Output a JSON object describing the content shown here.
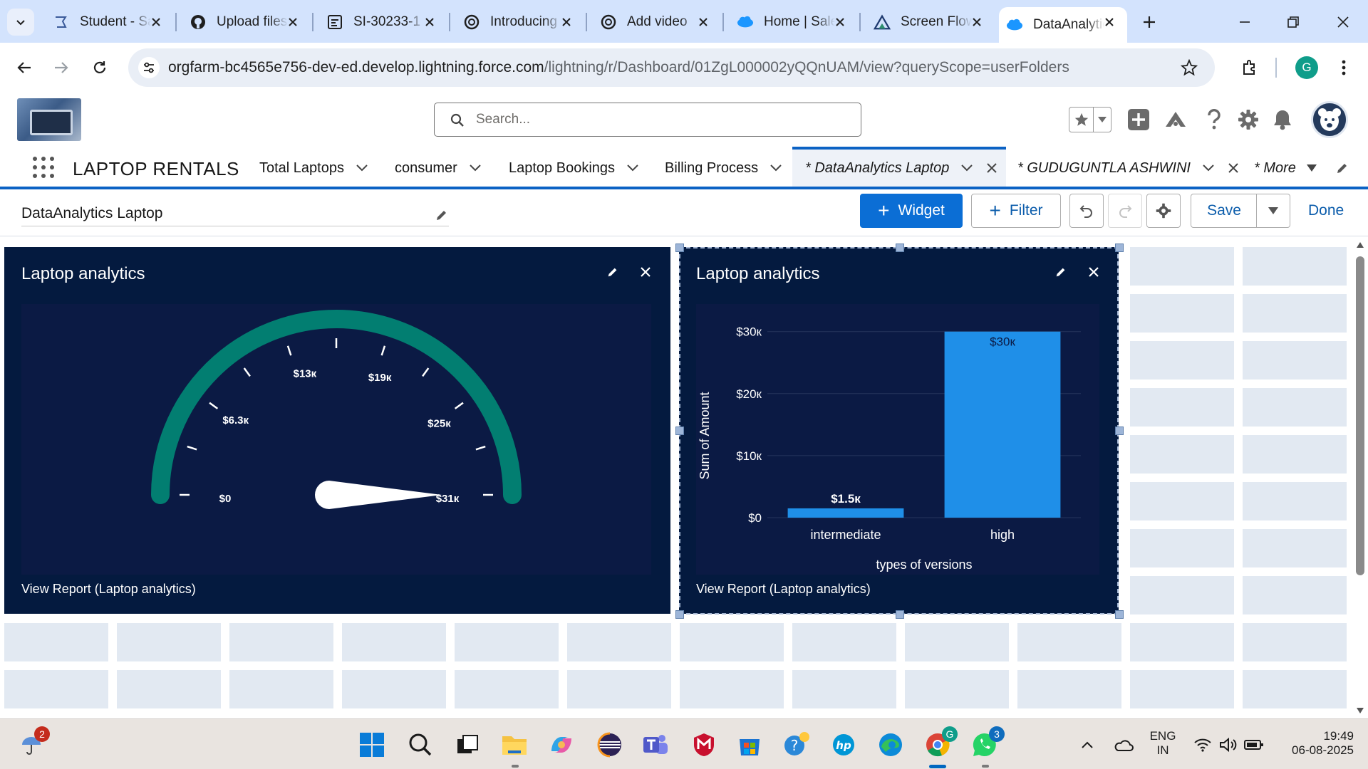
{
  "browser": {
    "tabs": [
      {
        "label": "Student - Salesforce",
        "icon": "salesforce-student-icon"
      },
      {
        "label": "Upload files",
        "icon": "github-icon"
      },
      {
        "label": "SI-30233-1",
        "icon": "document-icon"
      },
      {
        "label": "Introducing",
        "icon": "openai-icon"
      },
      {
        "label": "Add video",
        "icon": "openai-icon"
      },
      {
        "label": "Home | Salesforce",
        "icon": "salesforce-cloud-icon"
      },
      {
        "label": "Screen Flow",
        "icon": "trailhead-icon"
      },
      {
        "label": "DataAnalytics",
        "icon": "salesforce-cloud-icon",
        "active": true
      }
    ],
    "url_host": "orgfarm-bc4565e756-dev-ed.develop.lightning.force.com",
    "url_path": "/lightning/r/Dashboard/01ZgL000002yQQnUAM/view?queryScope=userFolders",
    "profile_initial": "G"
  },
  "header": {
    "search_placeholder": "Search..."
  },
  "nav": {
    "app_name": "LAPTOP RENTALS",
    "items": [
      {
        "label": "Total Laptops"
      },
      {
        "label": "consumer"
      },
      {
        "label": "Laptop Bookings"
      },
      {
        "label": "Billing Process"
      },
      {
        "label": "* DataAnalytics Laptop",
        "active": true
      },
      {
        "label": "* GUDUGUNTLA ASHWINI"
      },
      {
        "label": "* More"
      }
    ]
  },
  "editbar": {
    "dashboard_title": "DataAnalytics Laptop",
    "widget_label": "Widget",
    "filter_label": "Filter",
    "save_label": "Save",
    "done_label": "Done"
  },
  "gauge_widget": {
    "title": "Laptop analytics",
    "link": "View Report (Laptop analytics)",
    "chart_data": {
      "type": "gauge",
      "min": 0,
      "max": 31000,
      "value": 31000,
      "labels": [
        "$0",
        "$6.3к",
        "$13к",
        "$19к",
        "$25к",
        "$31к"
      ],
      "label_values": [
        0,
        6300,
        13000,
        19000,
        25000,
        31000
      ],
      "colors": {
        "arc": "#027e71",
        "needle": "#ffffff"
      }
    }
  },
  "bar_widget": {
    "title": "Laptop analytics",
    "link": "View Report (Laptop analytics)",
    "chart_data": {
      "type": "bar",
      "categories": [
        "intermediate",
        "high"
      ],
      "values": [
        1500,
        30000
      ],
      "data_labels": [
        "$1.5к",
        "$30к"
      ],
      "xlabel": "types of versions",
      "ylabel": "Sum of Amount",
      "yticks": [
        0,
        10000,
        20000,
        30000
      ],
      "ytick_labels": [
        "$0",
        "$10к",
        "$20к",
        "$30к"
      ],
      "ylim": [
        0,
        31000
      ],
      "grid": true,
      "colors": {
        "bar": "#1f8fe8"
      }
    }
  },
  "taskbar": {
    "weather_badge": "2",
    "chrome_badge": "G",
    "whatsapp_badge": "3",
    "lang_line1": "ENG",
    "lang_line2": "IN",
    "time": "19:49",
    "date": "06-08-2025"
  }
}
